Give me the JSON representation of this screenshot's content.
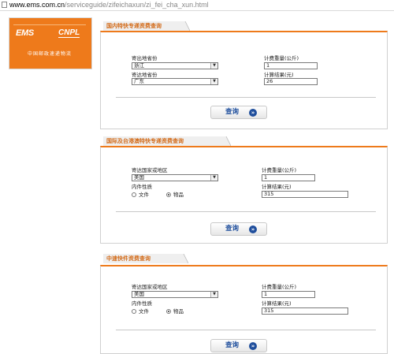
{
  "address_bar": {
    "host": "www.ems.com.cn",
    "path": "/serviceguide/zifeichaxun/zi_fei_cha_xun.html"
  },
  "logo": {
    "ems_text": "EMS",
    "cnpl_text": "CNPL",
    "subtitle": "中国邮政速递物流",
    "color": "#ee7a1b"
  },
  "domestic": {
    "title": "国内特快专递资费查询",
    "origin_label": "寄出地省份",
    "origin_value": "浙江",
    "dest_label": "寄达地省份",
    "dest_value": "广东",
    "weight_label": "计费重量(公斤)",
    "weight_value": "1",
    "result_label": "计算结果(元)",
    "result_value": "26",
    "query_label": "查询"
  },
  "international": {
    "title": "国际及台港澳特快专递资费查询",
    "country_label": "寄达国家或地区",
    "country_value": "美国",
    "type_label": "内件性质",
    "type_options": [
      "文件",
      "物品"
    ],
    "type_selected": "物品",
    "weight_label": "计费重量(公斤)",
    "weight_value": "1",
    "result_label": "计算结果(元)",
    "result_value": "315",
    "query_label": "查询"
  },
  "express": {
    "title": "中速快件资费查询",
    "country_label": "寄达国家或地区",
    "country_value": "美国",
    "type_label": "内件性质",
    "type_options": [
      "文件",
      "物品"
    ],
    "type_selected": "物品",
    "weight_label": "计费重量(公斤)",
    "weight_value": "1",
    "result_label": "计算结果(元)",
    "result_value": "315",
    "query_label": "查询"
  },
  "colors": {
    "accent": "#ee7a1b",
    "title_text": "#d36b19",
    "button_text": "#1f4e9c"
  }
}
